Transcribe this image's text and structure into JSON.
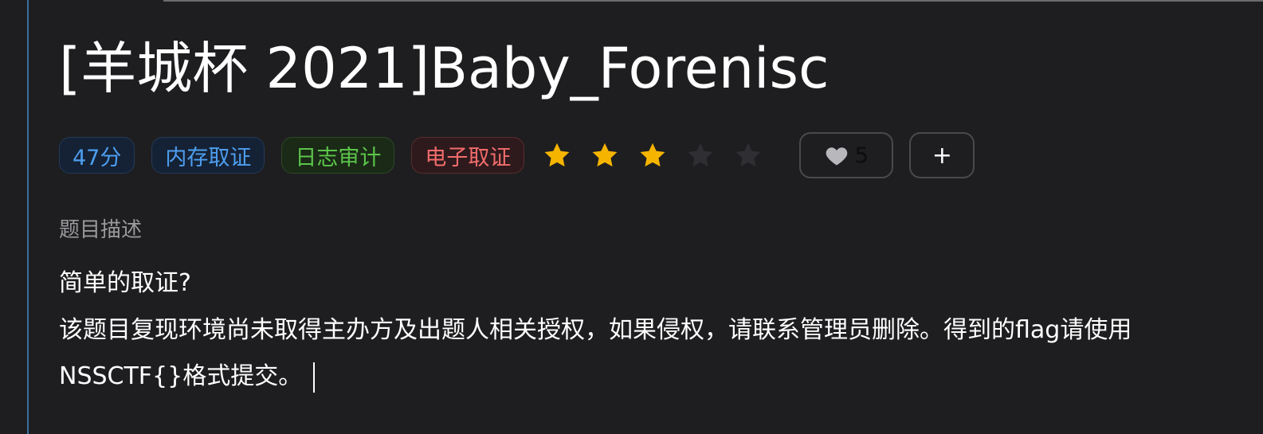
{
  "challenge": {
    "title": "[羊城杯 2021]Baby_Forenisc",
    "score": "47分",
    "tags": [
      {
        "label": "内存取证",
        "color": "#4d9ef0"
      },
      {
        "label": "日志审计",
        "color": "#5cc44a"
      },
      {
        "label": "电子取证",
        "color": "#f46c6c"
      }
    ],
    "difficulty": {
      "rating": 3,
      "max": 5,
      "filled_color": "#f5b400",
      "empty_color": "#2f2f33",
      "icon": "star-icon"
    },
    "likes": {
      "count": "5",
      "icon": "heart-icon"
    },
    "add_label": "+",
    "description_label": "题目描述",
    "description_lines": [
      "简单的取证?",
      "该题目复现环境尚未取得主办方及出题人相关授权，如果侵权，请联系管理员删除。得到的flag请使用NSSCTF{}格式提交。"
    ]
  }
}
